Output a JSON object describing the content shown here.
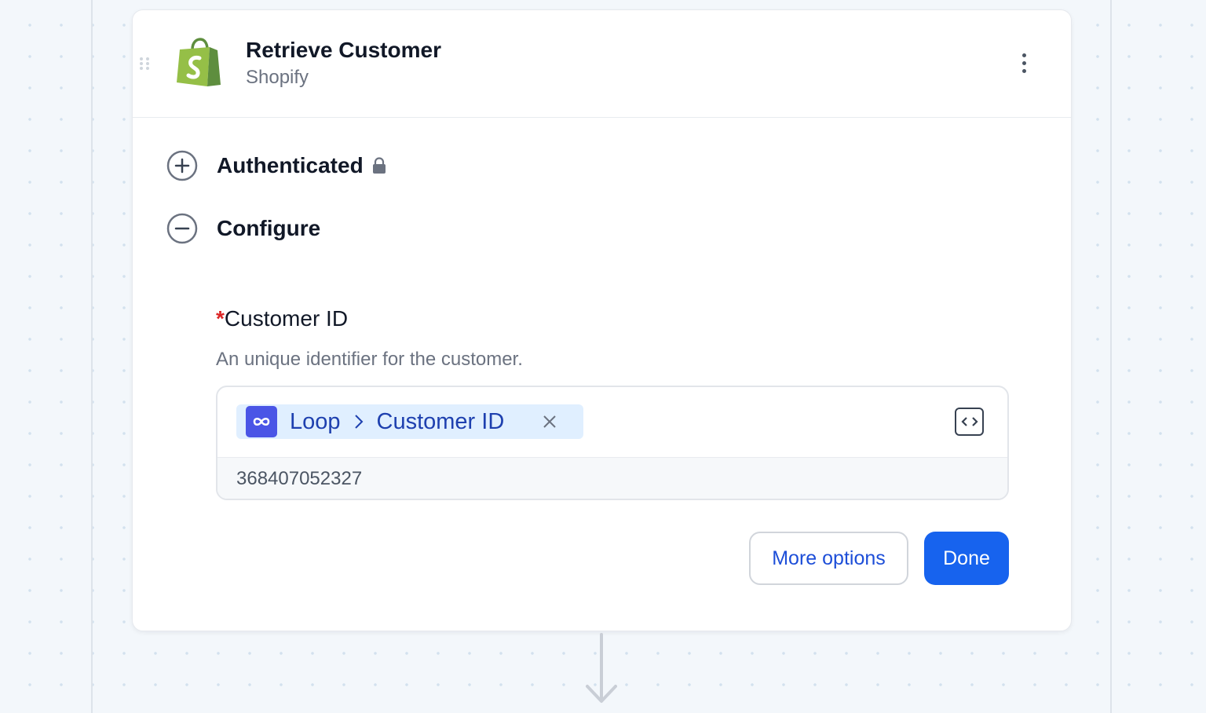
{
  "step": {
    "title": "Retrieve Customer",
    "app_name": "Shopify",
    "app_icon": "shopify-bag-icon",
    "menu_icon": "kebab-menu-icon"
  },
  "sections": [
    {
      "label": "Authenticated",
      "state": "collapsed",
      "icon": "plus-circle-icon",
      "badge_icon": "lock-icon"
    },
    {
      "label": "Configure",
      "state": "expanded",
      "icon": "minus-circle-icon"
    }
  ],
  "field": {
    "required_marker": "*",
    "label": "Customer ID",
    "help": "An unique identifier for the customer.",
    "token": {
      "icon": "loop-infinity-icon",
      "source": "Loop",
      "separator_icon": "chevron-right-icon",
      "field": "Customer ID",
      "remove_icon": "close-icon"
    },
    "code_toggle_icon": "code-brackets-icon",
    "resolved_value": "368407052327"
  },
  "actions": {
    "more_options": "More options",
    "done": "Done"
  },
  "colors": {
    "accent": "#1763ee",
    "token_bg": "#e0efff",
    "token_text": "#1e40af",
    "loop_icon_bg": "#4a55e6",
    "shopify_green": "#95bf47",
    "required": "#dc2626"
  }
}
